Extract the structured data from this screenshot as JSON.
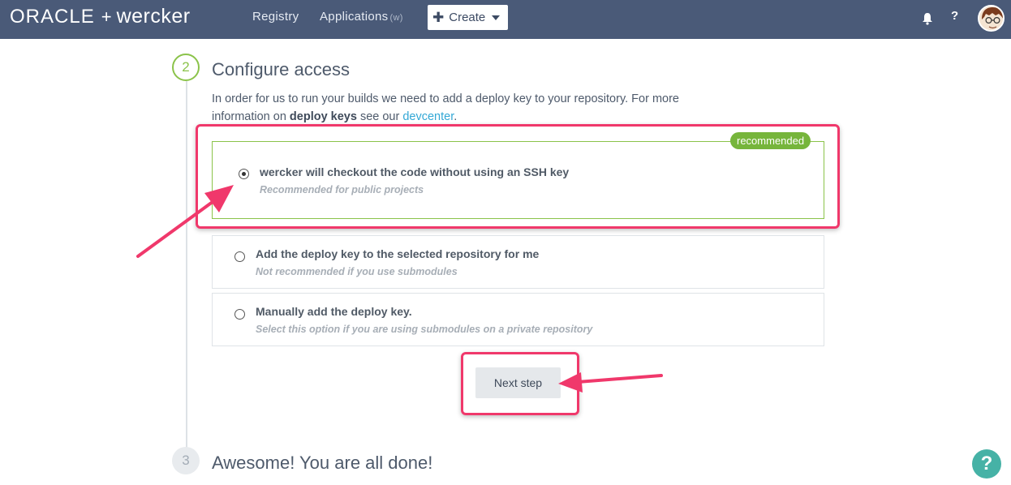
{
  "nav": {
    "logo_brand": "ORACLE",
    "logo_plus": "+",
    "logo_product": "wercker",
    "links": [
      {
        "label": "Registry"
      },
      {
        "label": "Applications",
        "sub": "(w)"
      }
    ],
    "create_label": "Create",
    "help_label": "?",
    "icons": [
      "bell-icon",
      "question-icon",
      "avatar"
    ]
  },
  "steps": {
    "current_number": "2",
    "current_title": "Configure access",
    "intro_part1": "In order for us to run your builds we need to add a deploy key to your repository. For more information on ",
    "intro_bold": "deploy keys",
    "intro_part2": " see our ",
    "intro_link": "devcenter",
    "intro_end": ".",
    "next_number": "3",
    "next_title": "Awesome! You are all done!"
  },
  "options": [
    {
      "title": "wercker will checkout the code without using an SSH key",
      "subtitle": "Recommended for public projects",
      "selected": true,
      "badge": "recommended"
    },
    {
      "title": "Add the deploy key to the selected repository for me",
      "subtitle": "Not recommended if you use submodules",
      "selected": false
    },
    {
      "title": "Manually add the deploy key.",
      "subtitle": "Select this option if you are using submodules on a private repository",
      "selected": false
    }
  ],
  "next_button_label": "Next step",
  "help_fab_label": "?",
  "colors": {
    "topbar": "#4a5a78",
    "accent_green": "#8bc34a",
    "badge_green": "#76b53b",
    "annotation": "#f0386b",
    "link": "#33a8d6",
    "help_fab": "#46b2a6"
  }
}
